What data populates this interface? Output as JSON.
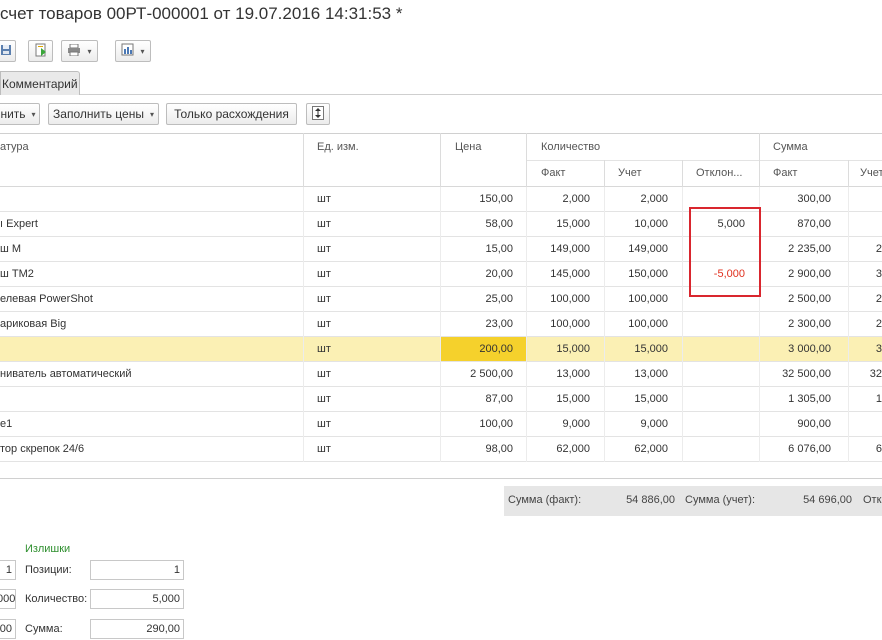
{
  "title": "счет товаров 00РТ-000001 от 19.07.2016 14:31:53 *",
  "toolbar": {
    "icons": [
      "save-icon",
      "post-icon",
      "print-icon",
      "report-icon"
    ]
  },
  "tabs": [
    {
      "label": "Комментарий"
    }
  ],
  "commands": {
    "fill_label": "нить",
    "fill_prices_label": "Заполнить цены",
    "only_diff_label": "Только расхождения"
  },
  "table": {
    "headers": {
      "name": "атура",
      "unit": "Ед. изм.",
      "price": "Цена",
      "quantity": "Количество",
      "sum": "Сумма",
      "qty_fact": "Факт",
      "qty_acc": "Учет",
      "qty_dev": "Отклон...",
      "sum_fact": "Факт",
      "sum_acc": "Учет"
    },
    "rows": [
      {
        "name": "",
        "unit": "шт",
        "price": "150,00",
        "fact": "2,000",
        "acc": "2,000",
        "dev": "",
        "sum_fact": "300,00",
        "sum_acc": ""
      },
      {
        "name": "ı Expert",
        "unit": "шт",
        "price": "58,00",
        "fact": "15,000",
        "acc": "10,000",
        "dev": "5,000",
        "sum_fact": "870,00",
        "sum_acc": ""
      },
      {
        "name": "ш M",
        "unit": "шт",
        "price": "15,00",
        "fact": "149,000",
        "acc": "149,000",
        "dev": "",
        "sum_fact": "2 235,00",
        "sum_acc": "2"
      },
      {
        "name": "ш TM2",
        "unit": "шт",
        "price": "20,00",
        "fact": "145,000",
        "acc": "150,000",
        "dev": "-5,000",
        "sum_fact": "2 900,00",
        "sum_acc": "3"
      },
      {
        "name": "елевая PowerShot",
        "unit": "шт",
        "price": "25,00",
        "fact": "100,000",
        "acc": "100,000",
        "dev": "",
        "sum_fact": "2 500,00",
        "sum_acc": "2"
      },
      {
        "name": "ариковая Big",
        "unit": "шт",
        "price": "23,00",
        "fact": "100,000",
        "acc": "100,000",
        "dev": "",
        "sum_fact": "2 300,00",
        "sum_acc": "2"
      },
      {
        "name": "",
        "unit": "шт",
        "price": "200,00",
        "fact": "15,000",
        "acc": "15,000",
        "dev": "",
        "sum_fact": "3 000,00",
        "sum_acc": "3"
      },
      {
        "name": "ниватель автоматический",
        "unit": "шт",
        "price": "2 500,00",
        "fact": "13,000",
        "acc": "13,000",
        "dev": "",
        "sum_fact": "32 500,00",
        "sum_acc": "32"
      },
      {
        "name": "",
        "unit": "шт",
        "price": "87,00",
        "fact": "15,000",
        "acc": "15,000",
        "dev": "",
        "sum_fact": "1 305,00",
        "sum_acc": "1"
      },
      {
        "name": "e1",
        "unit": "шт",
        "price": "100,00",
        "fact": "9,000",
        "acc": "9,000",
        "dev": "",
        "sum_fact": "900,00",
        "sum_acc": ""
      },
      {
        "name": "тор скрепок 24/6",
        "unit": "шт",
        "price": "98,00",
        "fact": "62,000",
        "acc": "62,000",
        "dev": "",
        "sum_fact": "6 076,00",
        "sum_acc": "6"
      }
    ]
  },
  "totals": {
    "fact_label": "Сумма (факт):",
    "fact_value": "54 886,00",
    "acc_label": "Сумма (учет):",
    "acc_value": "54 696,00",
    "dev_label": "Отк"
  },
  "surplus": {
    "heading": "Излишки",
    "positions_label": "Позиции:",
    "positions_value": "1",
    "quantity_label": "Количество:",
    "quantity_value": "5,000",
    "sum_label": "Сумма:",
    "sum_value": "290,00"
  },
  "left_fields": {
    "positions": "1",
    "quantity": "000",
    "sum": "00"
  },
  "colors": {
    "selected_row": "#fbf0b4",
    "selected_cell": "#f5d12c",
    "negative": "#e0301e",
    "highlight_box": "#d9262e",
    "surplus_heading": "#2f8f2f"
  }
}
